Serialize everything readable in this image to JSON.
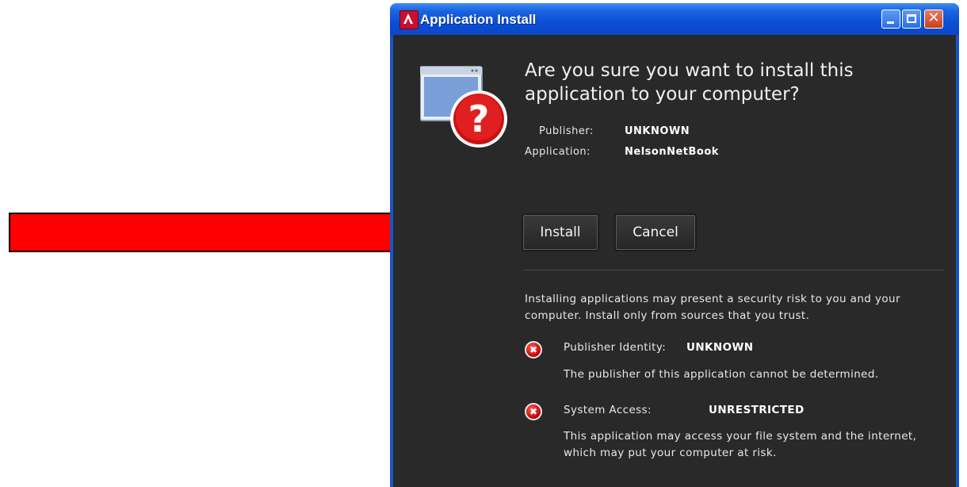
{
  "window": {
    "title": "Application Install",
    "app_icon": "adobe-air-icon"
  },
  "prompt": {
    "question": "Are you sure you want to install this application to your computer?",
    "icon": "question-icon",
    "publisher_label": "Publisher:",
    "publisher_value": "UNKNOWN",
    "application_label": "Application:",
    "application_value": "NelsonNetBook"
  },
  "buttons": {
    "install_label": "Install",
    "cancel_label": "Cancel"
  },
  "warning": {
    "text": "Installing applications may present a security risk to you and your computer. Install only from sources that you trust.",
    "items": [
      {
        "label": "Publisher Identity:",
        "value": "UNKNOWN",
        "description": "The publisher of this application cannot be determined."
      },
      {
        "label": "System Access:",
        "value": "UNRESTRICTED",
        "description": "This application may access your file system and the internet, which may put your computer at risk."
      }
    ]
  },
  "annotation": {
    "arrow_color": "#ff0000"
  }
}
